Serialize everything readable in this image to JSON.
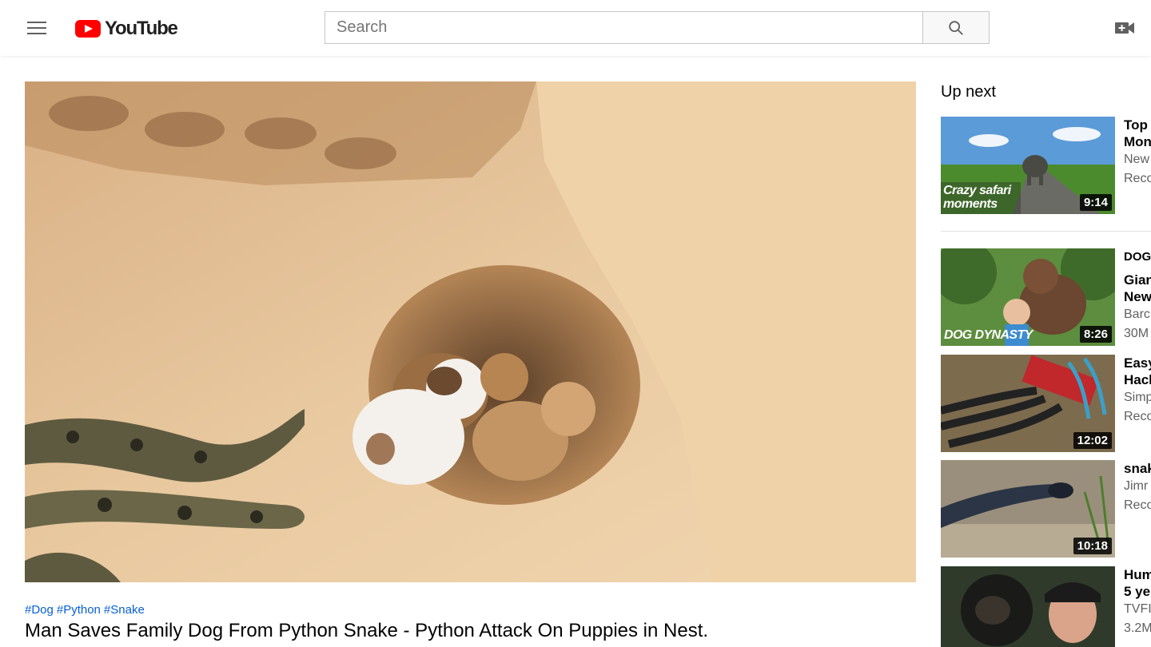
{
  "header": {
    "logo_text": "YouTube",
    "search_placeholder": "Search"
  },
  "video": {
    "hashtags": [
      "#Dog",
      "#Python",
      "#Snake"
    ],
    "title": "Man Saves Family Dog From Python Snake - Python Attack On Puppies in Nest."
  },
  "sidebar": {
    "up_next_label": "Up next",
    "items": [
      {
        "title_lines": [
          "Top",
          "Mon"
        ],
        "meta_lines": [
          "New",
          "Reco"
        ],
        "duration": "9:14",
        "thumb_text": "Crazy safari moments"
      },
      {
        "title_lines": [
          "DOG",
          "Gian",
          "New"
        ],
        "meta_lines": [
          "Barc",
          "30M"
        ],
        "duration": "8:26",
        "thumb_text": "DOG DYNASTY"
      },
      {
        "title_lines": [
          "Easy",
          "Hacl"
        ],
        "meta_lines": [
          "Simp",
          "Reco"
        ],
        "duration": "12:02"
      },
      {
        "title_lines": [
          "snak"
        ],
        "meta_lines": [
          "Jimr",
          "Reco"
        ],
        "duration": "10:18"
      },
      {
        "title_lines": [
          "Hum",
          "5 ye"
        ],
        "meta_lines": [
          "TVFI",
          "3.2M"
        ],
        "duration": ""
      }
    ]
  }
}
